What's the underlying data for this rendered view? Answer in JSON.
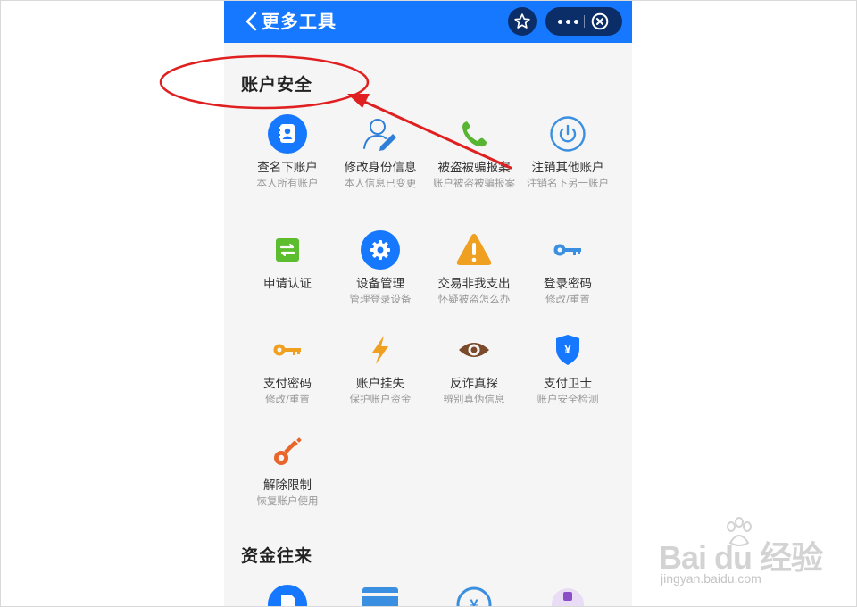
{
  "header": {
    "title": "更多工具",
    "back_icon": "chevron-left-icon",
    "favorite_icon": "star-icon",
    "more_icon": "more-dots-icon",
    "close_icon": "close-circle-icon",
    "color": "#1677ff"
  },
  "sections": [
    {
      "title": "账户安全",
      "items": [
        {
          "label": "查名下账户",
          "sub": "本人所有账户",
          "icon": "contact-book-icon"
        },
        {
          "label": "修改身份信息",
          "sub": "本人信息已变更",
          "icon": "user-edit-icon"
        },
        {
          "label": "被盗被骗报案",
          "sub": "账户被盗被骗报案",
          "icon": "phone-icon"
        },
        {
          "label": "注销其他账户",
          "sub": "注销名下另一账户",
          "icon": "power-icon"
        },
        {
          "label": "申请认证",
          "sub": "",
          "icon": "refresh-icon"
        },
        {
          "label": "设备管理",
          "sub": "管理登录设备",
          "icon": "gear-icon"
        },
        {
          "label": "交易非我支出",
          "sub": "怀疑被盗怎么办",
          "icon": "warning-icon"
        },
        {
          "label": "登录密码",
          "sub": "修改/重置",
          "icon": "key-icon"
        },
        {
          "label": "支付密码",
          "sub": "修改/重置",
          "icon": "key-icon"
        },
        {
          "label": "账户挂失",
          "sub": "保护账户资金",
          "icon": "lightning-icon"
        },
        {
          "label": "反诈真探",
          "sub": "辨别真伪信息",
          "icon": "eye-icon"
        },
        {
          "label": "支付卫士",
          "sub": "账户安全检测",
          "icon": "shield-yen-icon"
        },
        {
          "label": "解除限制",
          "sub": "恢复账户使用",
          "icon": "key-icon"
        }
      ]
    },
    {
      "title": "资金往来",
      "items": [
        {
          "icon": "document-icon"
        },
        {
          "icon": "card-icon"
        },
        {
          "icon": "yen-circle-icon"
        },
        {
          "icon": "refund-icon"
        }
      ]
    }
  ],
  "watermark": {
    "text": "Bai du 经验",
    "url_text": "jingyan.baidu.com"
  }
}
